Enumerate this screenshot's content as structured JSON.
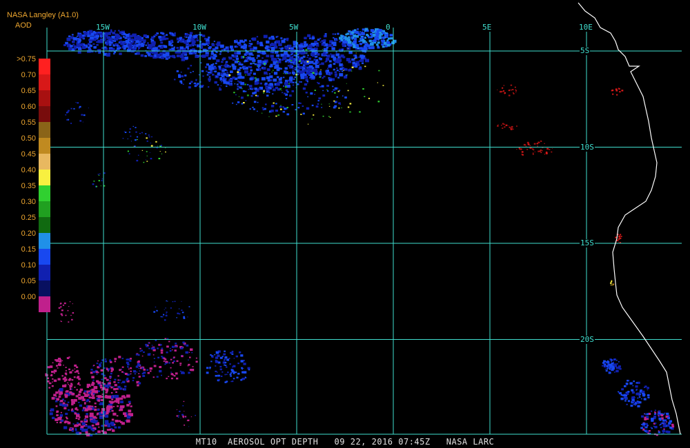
{
  "header": {
    "title": "NASA Langley (A1.0)",
    "subtitle": "AOD"
  },
  "legend": [
    {
      "label": ">0.75",
      "color": "#ff2020"
    },
    {
      "label": "0.70",
      "color": "#d81818"
    },
    {
      "label": "0.65",
      "color": "#a81010"
    },
    {
      "label": "0.60",
      "color": "#780c0c"
    },
    {
      "label": "0.55",
      "color": "#8a6418"
    },
    {
      "label": "0.50",
      "color": "#c08a20"
    },
    {
      "label": "0.45",
      "color": "#e8b860"
    },
    {
      "label": "0.40",
      "color": "#f8f040"
    },
    {
      "label": "0.35",
      "color": "#30d030"
    },
    {
      "label": "0.30",
      "color": "#20a020"
    },
    {
      "label": "0.25",
      "color": "#106a10"
    },
    {
      "label": "0.20",
      "color": "#2090e8"
    },
    {
      "label": "0.15",
      "color": "#1848f0"
    },
    {
      "label": "0.10",
      "color": "#1020b0"
    },
    {
      "label": "0.05",
      "color": "#081060"
    },
    {
      "label": "0.00",
      "color": "#c0208c"
    }
  ],
  "grid": {
    "longitudes": [
      {
        "label": "15W",
        "value": -15
      },
      {
        "label": "10W",
        "value": -10
      },
      {
        "label": "5W",
        "value": -5
      },
      {
        "label": "0",
        "value": 0
      },
      {
        "label": "5E",
        "value": 5
      },
      {
        "label": "10E",
        "value": 10
      }
    ],
    "latitudes": [
      {
        "label": "5S",
        "value": -5
      },
      {
        "label": "10S",
        "value": -10
      },
      {
        "label": "15S",
        "value": -15
      },
      {
        "label": "20S",
        "value": -20
      }
    ],
    "color": "#40e0d0"
  },
  "coast_color": "#ffffff",
  "footer": "MT10  AEROSOL OPT DEPTH   09 22, 2016 07:45Z   NASA LARC"
}
